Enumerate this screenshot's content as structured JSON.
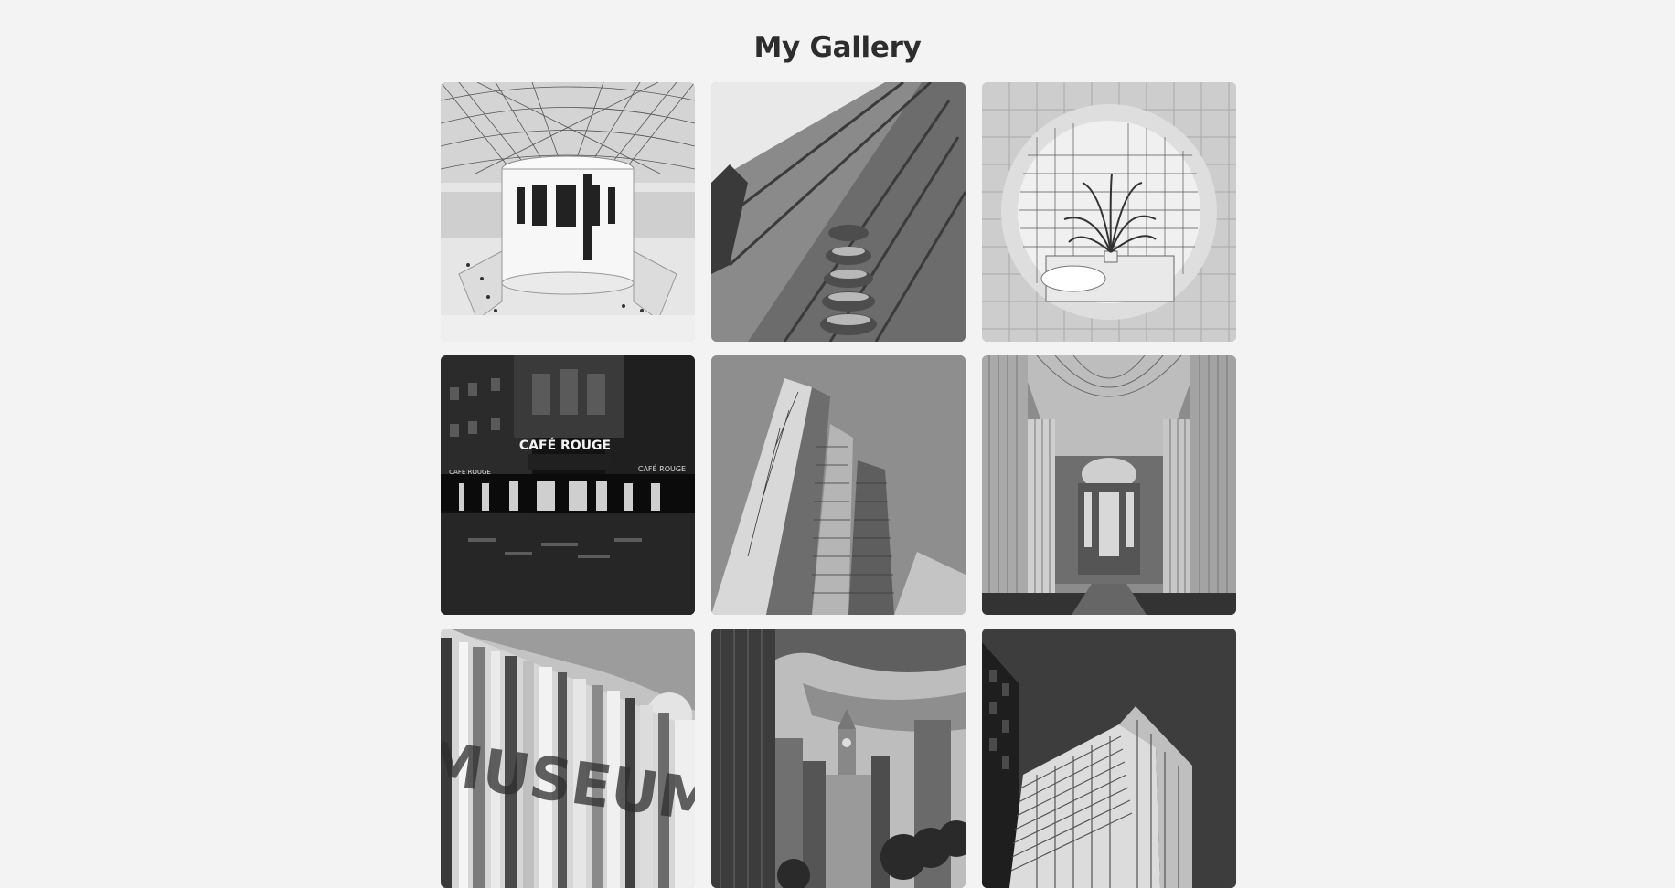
{
  "page": {
    "title": "My Gallery"
  },
  "gallery": {
    "images": [
      {
        "subject": "museum-glass-roof-atrium"
      },
      {
        "subject": "ornate-building-facade-looking-up"
      },
      {
        "subject": "round-window-tiled-room-with-palm"
      },
      {
        "subject": "cafe-at-night",
        "sign_text": "CAFÉ ROUGE",
        "side_sign_left": "CAFÉ ROUGE",
        "side_sign_right": "CAFÉ ROUGE"
      },
      {
        "subject": "glass-skyscrapers"
      },
      {
        "subject": "cathedral-interior-columns"
      },
      {
        "subject": "museum-striped-facade",
        "sign_text": "MUSEUM"
      },
      {
        "subject": "city-skyline-clock-tower"
      },
      {
        "subject": "modern-highrise-dark-sky"
      }
    ]
  }
}
